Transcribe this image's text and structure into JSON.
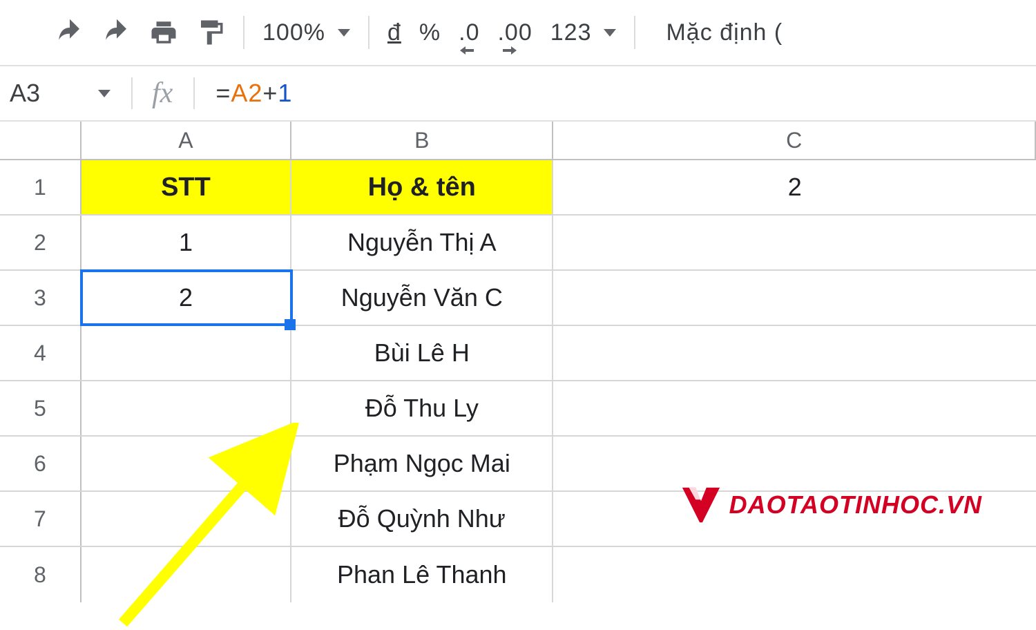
{
  "toolbar": {
    "zoom": "100%",
    "currency": "đ",
    "percent": "%",
    "dec_decrease": ".0",
    "dec_increase": ".00",
    "num_format": "123",
    "font": "Mặc định ("
  },
  "formula_bar": {
    "cell_ref": "A3",
    "fx_label": "fx",
    "formula_prefix": "=",
    "formula_ref": "A2",
    "formula_op": "+",
    "formula_lit": "1"
  },
  "columns": {
    "A": "A",
    "B": "B",
    "C": "C"
  },
  "row_labels": [
    "1",
    "2",
    "3",
    "4",
    "5",
    "6",
    "7",
    "8"
  ],
  "cells": {
    "A1": "STT",
    "B1": "Họ & tên",
    "C1": "2",
    "A2": "1",
    "B2": "Nguyễn Thị A",
    "A3": "2",
    "B3": "Nguyễn Văn C",
    "B4": "Bùi Lê H",
    "B5": "Đỗ Thu Ly",
    "B6": "Phạm Ngọc Mai",
    "B7": "Đỗ Quỳnh Như",
    "B8": "Phan Lê Thanh"
  },
  "watermark": "DAOTAOTINHOC.VN"
}
